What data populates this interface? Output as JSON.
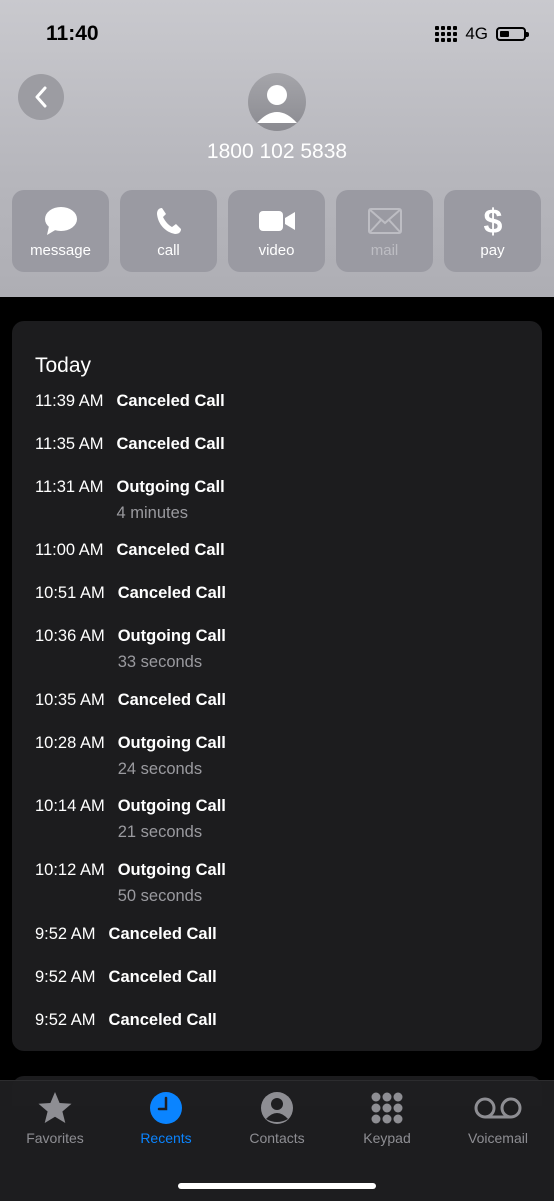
{
  "status": {
    "time": "11:40",
    "network": "4G"
  },
  "contact": {
    "number": "1800 102 5838"
  },
  "actions": [
    {
      "label": "message",
      "icon": "message-bubble-icon",
      "enabled": true
    },
    {
      "label": "call",
      "icon": "phone-icon",
      "enabled": true
    },
    {
      "label": "video",
      "icon": "video-camera-icon",
      "enabled": true
    },
    {
      "label": "mail",
      "icon": "envelope-icon",
      "enabled": false
    },
    {
      "label": "pay",
      "icon": "dollar-icon",
      "enabled": true
    }
  ],
  "history": {
    "heading": "Today",
    "calls": [
      {
        "time": "11:39 AM",
        "kind": "Canceled Call",
        "duration": ""
      },
      {
        "time": "11:35 AM",
        "kind": "Canceled Call",
        "duration": ""
      },
      {
        "time": "11:31 AM",
        "kind": "Outgoing Call",
        "duration": "4 minutes"
      },
      {
        "time": "11:00 AM",
        "kind": "Canceled Call",
        "duration": ""
      },
      {
        "time": "10:51 AM",
        "kind": "Canceled Call",
        "duration": ""
      },
      {
        "time": "10:36 AM",
        "kind": "Outgoing Call",
        "duration": "33 seconds"
      },
      {
        "time": "10:35 AM",
        "kind": "Canceled Call",
        "duration": ""
      },
      {
        "time": "10:28 AM",
        "kind": "Outgoing Call",
        "duration": "24 seconds"
      },
      {
        "time": "10:14 AM",
        "kind": "Outgoing Call",
        "duration": "21 seconds"
      },
      {
        "time": "10:12 AM",
        "kind": "Outgoing Call",
        "duration": "50 seconds"
      },
      {
        "time": "9:52 AM",
        "kind": "Canceled Call",
        "duration": ""
      },
      {
        "time": "9:52 AM",
        "kind": "Canceled Call",
        "duration": ""
      },
      {
        "time": "9:52 AM",
        "kind": "Canceled Call",
        "duration": ""
      }
    ]
  },
  "tabs": [
    {
      "label": "Favorites",
      "icon": "star-icon",
      "active": false
    },
    {
      "label": "Recents",
      "icon": "clock-icon",
      "active": true
    },
    {
      "label": "Contacts",
      "icon": "person-circle-icon",
      "active": false
    },
    {
      "label": "Keypad",
      "icon": "keypad-icon",
      "active": false
    },
    {
      "label": "Voicemail",
      "icon": "voicemail-icon",
      "active": false
    }
  ],
  "colors": {
    "accent": "#0a84ff",
    "card": "#1c1c1e",
    "header": "#b6b6bc"
  }
}
